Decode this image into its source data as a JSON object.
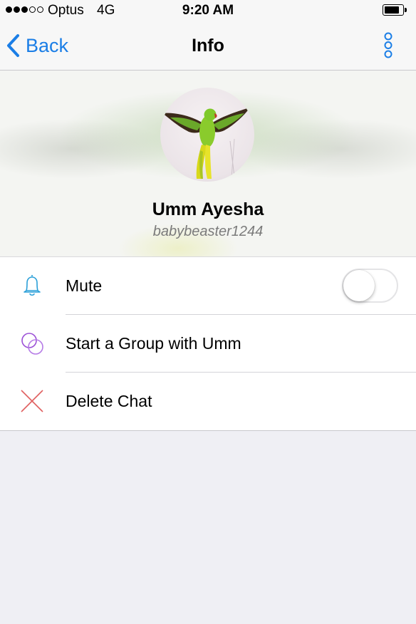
{
  "status_bar": {
    "carrier": "Optus",
    "network": "4G",
    "time": "9:20 AM",
    "signal_bars_filled": 3,
    "signal_bars_total": 5,
    "battery_level": 0.85
  },
  "nav": {
    "back_label": "Back",
    "title": "Info",
    "back_icon": "chevron-left-icon",
    "more_icon": "more-vertical-icon"
  },
  "profile": {
    "name": "Umm Ayesha",
    "username": "babybeaster1244",
    "avatar_icon": "parrot-photo"
  },
  "actions": {
    "mute": {
      "label": "Mute",
      "icon": "bell-icon",
      "icon_color": "#2a9fd8",
      "enabled": false
    },
    "start_group": {
      "label": "Start a Group with Umm",
      "icon": "group-circles-icon",
      "icon_color": "#a55ad8"
    },
    "delete_chat": {
      "label": "Delete Chat",
      "icon": "x-icon",
      "icon_color": "#e06060"
    }
  },
  "colors": {
    "accent": "#1b7ee6",
    "background": "#efeff4"
  }
}
